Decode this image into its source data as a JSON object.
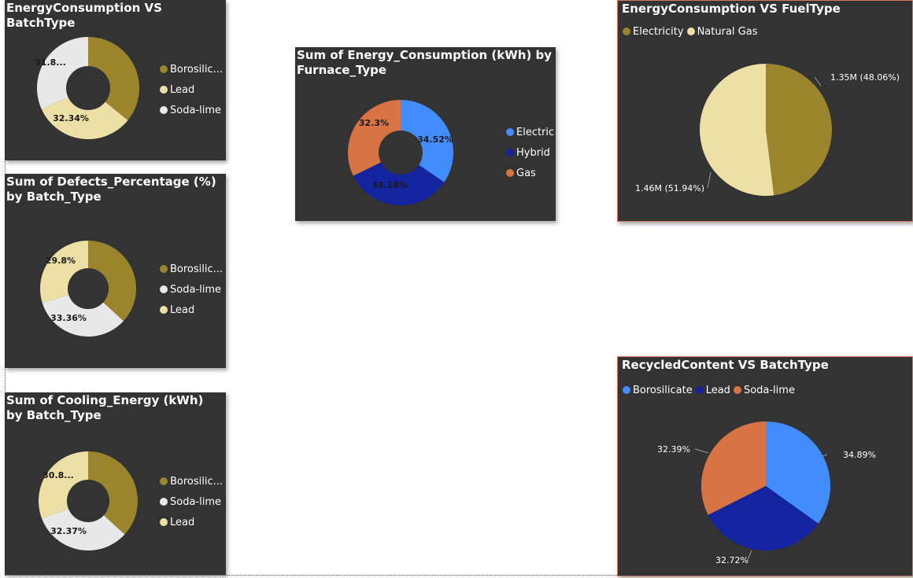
{
  "colors": {
    "olive": "#9b852c",
    "cream": "#ede0a4",
    "light": "#e8e8e8",
    "blue": "#418cff",
    "navy": "#1424a0",
    "orange": "#d87444"
  },
  "chart_data": [
    {
      "type": "pie",
      "donut": true,
      "title": "EnergyConsumption VS BatchType",
      "categories": [
        "Borosilic...",
        "Lead",
        "Soda-lime"
      ],
      "values": [
        35.86,
        32.34,
        31.8
      ],
      "colors": [
        "#9b852c",
        "#ede0a4",
        "#e8e8e8"
      ],
      "labels": [
        "",
        "32.34%",
        "31.8..."
      ],
      "legend": [
        "Borosilic...",
        "Lead",
        "Soda-lime"
      ],
      "legend_position": "right"
    },
    {
      "type": "pie",
      "donut": true,
      "title": "Sum of Defects_Percentage (%) by Batch_Type",
      "categories": [
        "Borosilic...",
        "Soda-lime",
        "Lead"
      ],
      "values": [
        36.84,
        33.36,
        29.8
      ],
      "colors": [
        "#9b852c",
        "#e8e8e8",
        "#ede0a4"
      ],
      "labels": [
        "",
        "33.36%",
        "29.8%"
      ],
      "legend": [
        "Borosilic...",
        "Soda-lime",
        "Lead"
      ],
      "legend_position": "right"
    },
    {
      "type": "pie",
      "donut": true,
      "title": "Sum of Cooling_Energy (kWh) by Batch_Type",
      "categories": [
        "Borosilic...",
        "Soda-lime",
        "Lead"
      ],
      "values": [
        36.83,
        32.37,
        30.8
      ],
      "colors": [
        "#9b852c",
        "#e8e8e8",
        "#ede0a4"
      ],
      "labels": [
        "",
        "32.37%",
        "30.8..."
      ],
      "legend": [
        "Borosilic...",
        "Soda-lime",
        "Lead"
      ],
      "legend_position": "right"
    },
    {
      "type": "pie",
      "donut": true,
      "title": "Sum of Energy_Consumption (kWh) by Furnace_Type",
      "categories": [
        "Electric",
        "Hybrid",
        "Gas"
      ],
      "values": [
        34.52,
        33.18,
        32.3
      ],
      "colors": [
        "#418cff",
        "#1424a0",
        "#d87444"
      ],
      "labels": [
        "34.52%",
        "33.18%",
        "32.3%"
      ],
      "legend": [
        "Electric",
        "Hybrid",
        "Gas"
      ],
      "legend_position": "right"
    },
    {
      "type": "pie",
      "donut": false,
      "title": "EnergyConsumption VS FuelType",
      "categories": [
        "Electricity",
        "Natural Gas"
      ],
      "values": [
        48.06,
        51.94
      ],
      "colors": [
        "#9b852c",
        "#ede0a4"
      ],
      "labels": [
        "1.35M (48.06%)",
        "1.46M (51.94%)"
      ],
      "legend": [
        "Electricity",
        "Natural Gas"
      ],
      "legend_position": "top-left"
    },
    {
      "type": "pie",
      "donut": false,
      "title": "RecycledContent VS BatchType",
      "categories": [
        "Borosilicate",
        "Lead",
        "Soda-lime"
      ],
      "values": [
        34.89,
        32.72,
        32.39
      ],
      "colors": [
        "#418cff",
        "#1424a0",
        "#d87444"
      ],
      "labels": [
        "34.89%",
        "32.72%",
        "32.39%"
      ],
      "legend": [
        "Borosilicate",
        "Lead",
        "Soda-lime"
      ],
      "legend_position": "top-left"
    }
  ]
}
